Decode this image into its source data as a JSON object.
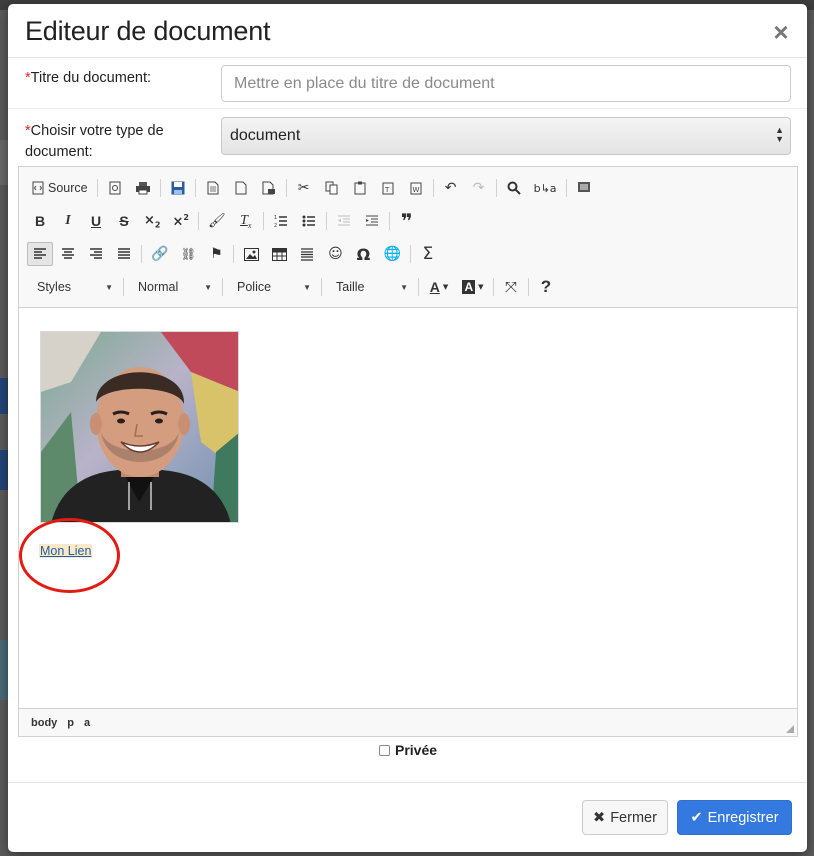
{
  "modal": {
    "title": "Editeur de document",
    "close_glyph": "×"
  },
  "form": {
    "title_field": {
      "required_mark": "*",
      "label": "Titre du document:",
      "placeholder": "Mettre en place du titre de document",
      "value": ""
    },
    "type_field": {
      "required_mark": "*",
      "label": "Choisir votre type de document:",
      "selected": "document"
    }
  },
  "toolbar": {
    "source_label": "Source",
    "styles_label": "Styles",
    "format_label": "Normal",
    "font_label": "Police",
    "size_label": "Taille",
    "help_label": "?"
  },
  "content": {
    "link_text": "Mon Lien",
    "image_alt": "photo"
  },
  "editor_path": [
    "body",
    "p",
    "a"
  ],
  "private_label": "Privée",
  "buttons": {
    "close_label": "Fermer",
    "save_label": "Enregistrer"
  },
  "colors": {
    "primary": "#3379e0",
    "highlight_circle": "#e21b14",
    "link": "#1f5fa8"
  }
}
